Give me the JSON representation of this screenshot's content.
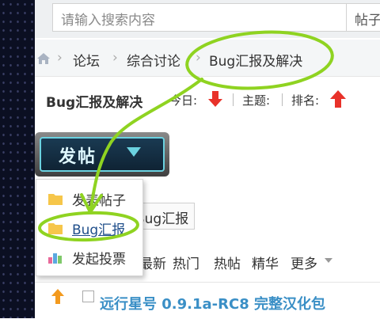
{
  "search": {
    "placeholder": "请输入搜索内容",
    "type_label": "帖子"
  },
  "breadcrumb": {
    "items": [
      "论坛",
      "综合讨论",
      "Bug汇报及解决"
    ]
  },
  "forum_header": {
    "title": "Bug汇报及解决",
    "today_label": "今日:",
    "topics_label": "主题:",
    "rank_label": "排名:"
  },
  "post_button": {
    "label": "发帖"
  },
  "post_menu": {
    "items": [
      "发表帖子",
      "Bug汇报",
      "发起投票"
    ]
  },
  "tag_filter": {
    "label": "Bug汇报"
  },
  "thread_filters": [
    "最新",
    "热门",
    "热帖",
    "精华",
    "更多"
  ],
  "thread": {
    "title": "远行星号 0.9.1a-RC8 完整汉化包"
  },
  "colors": {
    "accent": "#3a8fc6",
    "annotation": "#8fd321",
    "arrow_down": "#e8322a",
    "arrow_up": "#e8322a"
  }
}
